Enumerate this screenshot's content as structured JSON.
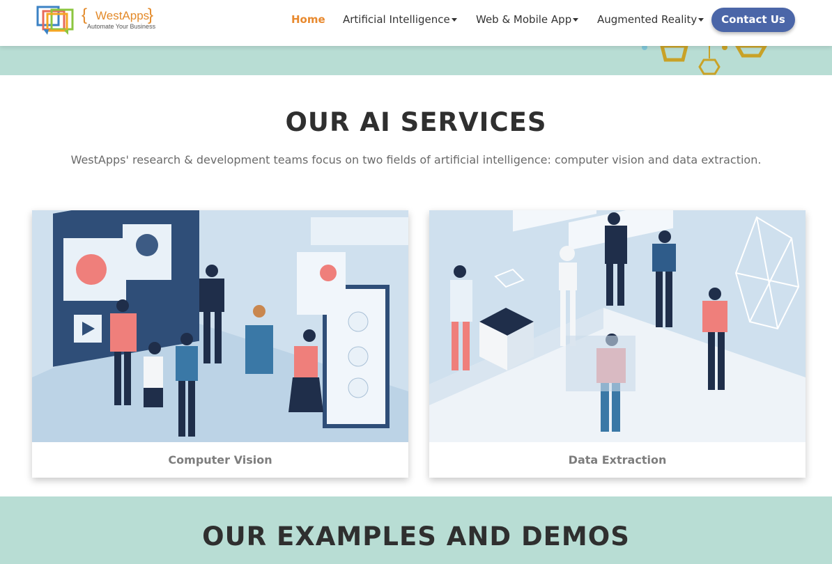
{
  "header": {
    "logo": {
      "name": "WestApps",
      "tagline": "Automate Your Business",
      "brace_left": "{",
      "brace_right": "}"
    },
    "nav": [
      {
        "label": "Home",
        "active": true,
        "dropdown": false
      },
      {
        "label": "Artificial Intelligence",
        "active": false,
        "dropdown": true
      },
      {
        "label": "Web & Mobile App",
        "active": false,
        "dropdown": true
      },
      {
        "label": "Augmented Reality",
        "active": false,
        "dropdown": true
      }
    ],
    "contact_label": "Contact Us"
  },
  "services": {
    "title": "OUR AI SERVICES",
    "subtitle": "WestApps' research & development teams focus on two fields of artificial intelligence: computer vision and data extraction.",
    "cards": [
      {
        "label": "Computer Vision"
      },
      {
        "label": "Data Extraction"
      }
    ]
  },
  "demos": {
    "title": "OUR EXAMPLES AND DEMOS"
  },
  "colors": {
    "accent": "#e8892e",
    "button": "#4b66a8",
    "band": "#b8ddd4",
    "heading": "#2f2f2f"
  }
}
